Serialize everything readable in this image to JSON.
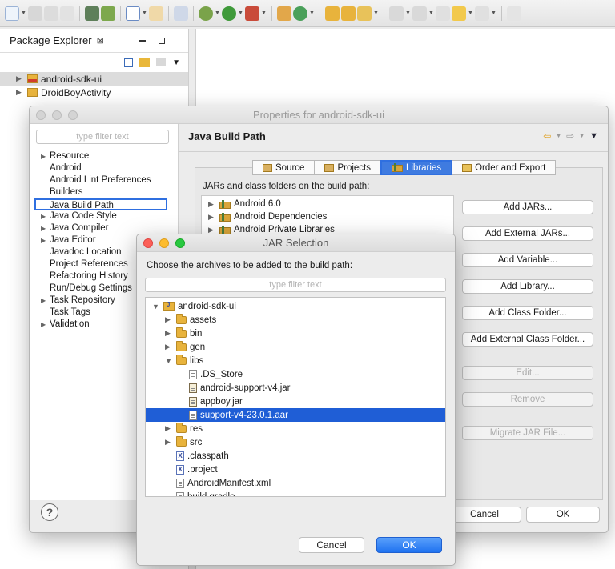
{
  "package_explorer": {
    "tab_title": "Package Explorer",
    "close_glyph": "⊠",
    "items": [
      {
        "label": "android-sdk-ui",
        "selected": true
      },
      {
        "label": "DroidBoyActivity",
        "selected": false
      }
    ]
  },
  "properties": {
    "title": "Properties for android-sdk-ui",
    "filter_placeholder": "type filter text",
    "nav": [
      {
        "label": "Resource",
        "expandable": true
      },
      {
        "label": "Android",
        "expandable": false
      },
      {
        "label": "Android Lint Preferences",
        "expandable": false
      },
      {
        "label": "Builders",
        "expandable": false
      },
      {
        "label": "Java Build Path",
        "expandable": false,
        "selected": true
      },
      {
        "label": "Java Code Style",
        "expandable": true
      },
      {
        "label": "Java Compiler",
        "expandable": true
      },
      {
        "label": "Java Editor",
        "expandable": true
      },
      {
        "label": "Javadoc Location",
        "expandable": false
      },
      {
        "label": "Project References",
        "expandable": false
      },
      {
        "label": "Refactoring History",
        "expandable": false
      },
      {
        "label": "Run/Debug Settings",
        "expandable": false
      },
      {
        "label": "Task Repository",
        "expandable": true
      },
      {
        "label": "Task Tags",
        "expandable": false
      },
      {
        "label": "Validation",
        "expandable": true
      }
    ],
    "section_title": "Java Build Path",
    "tabs": [
      {
        "label": "Source",
        "active": false
      },
      {
        "label": "Projects",
        "active": false
      },
      {
        "label": "Libraries",
        "active": true
      },
      {
        "label": "Order and Export",
        "active": false
      }
    ],
    "jars_label": "JARs and class folders on the build path:",
    "libraries": [
      "Android 6.0",
      "Android Dependencies",
      "Android Private Libraries"
    ],
    "buttons": [
      {
        "label": "Add JARs...",
        "enabled": true
      },
      {
        "label": "Add External JARs...",
        "enabled": true
      },
      {
        "label": "Add Variable...",
        "enabled": true
      },
      {
        "label": "Add Library...",
        "enabled": true
      },
      {
        "label": "Add Class Folder...",
        "enabled": true
      },
      {
        "label": "Add External Class Folder...",
        "enabled": true
      },
      {
        "label": "Edit...",
        "enabled": false
      },
      {
        "label": "Remove",
        "enabled": false
      },
      {
        "label": "Migrate JAR File...",
        "enabled": false
      }
    ],
    "cancel_label": "Cancel",
    "ok_label": "OK",
    "help_glyph": "?"
  },
  "jar_dialog": {
    "title": "JAR Selection",
    "message": "Choose the archives to be added to the build path:",
    "filter_placeholder": "type filter text",
    "tree": [
      {
        "label": "android-sdk-ui",
        "depth": 0,
        "icon": "project",
        "expanded": true
      },
      {
        "label": "assets",
        "depth": 1,
        "icon": "folder",
        "expanded": false
      },
      {
        "label": "bin",
        "depth": 1,
        "icon": "folder",
        "expanded": false
      },
      {
        "label": "gen",
        "depth": 1,
        "icon": "folder",
        "expanded": false
      },
      {
        "label": "libs",
        "depth": 1,
        "icon": "folder",
        "expanded": true
      },
      {
        "label": ".DS_Store",
        "depth": 2,
        "icon": "file"
      },
      {
        "label": "android-support-v4.jar",
        "depth": 2,
        "icon": "jar"
      },
      {
        "label": "appboy.jar",
        "depth": 2,
        "icon": "jar"
      },
      {
        "label": "support-v4-23.0.1.aar",
        "depth": 2,
        "icon": "file",
        "selected": true
      },
      {
        "label": "res",
        "depth": 1,
        "icon": "folder",
        "expanded": false
      },
      {
        "label": "src",
        "depth": 1,
        "icon": "folder",
        "expanded": false
      },
      {
        "label": ".classpath",
        "depth": 1,
        "icon": "xml"
      },
      {
        "label": ".project",
        "depth": 1,
        "icon": "xml"
      },
      {
        "label": "AndroidManifest.xml",
        "depth": 1,
        "icon": "manifest"
      },
      {
        "label": "build.gradle",
        "depth": 1,
        "icon": "file"
      }
    ],
    "cancel_label": "Cancel",
    "ok_label": "OK"
  },
  "colors": {
    "selection": "#1f5ed6",
    "highlight_border": "#2f6fe0",
    "primary_button": "#1f72f0"
  }
}
